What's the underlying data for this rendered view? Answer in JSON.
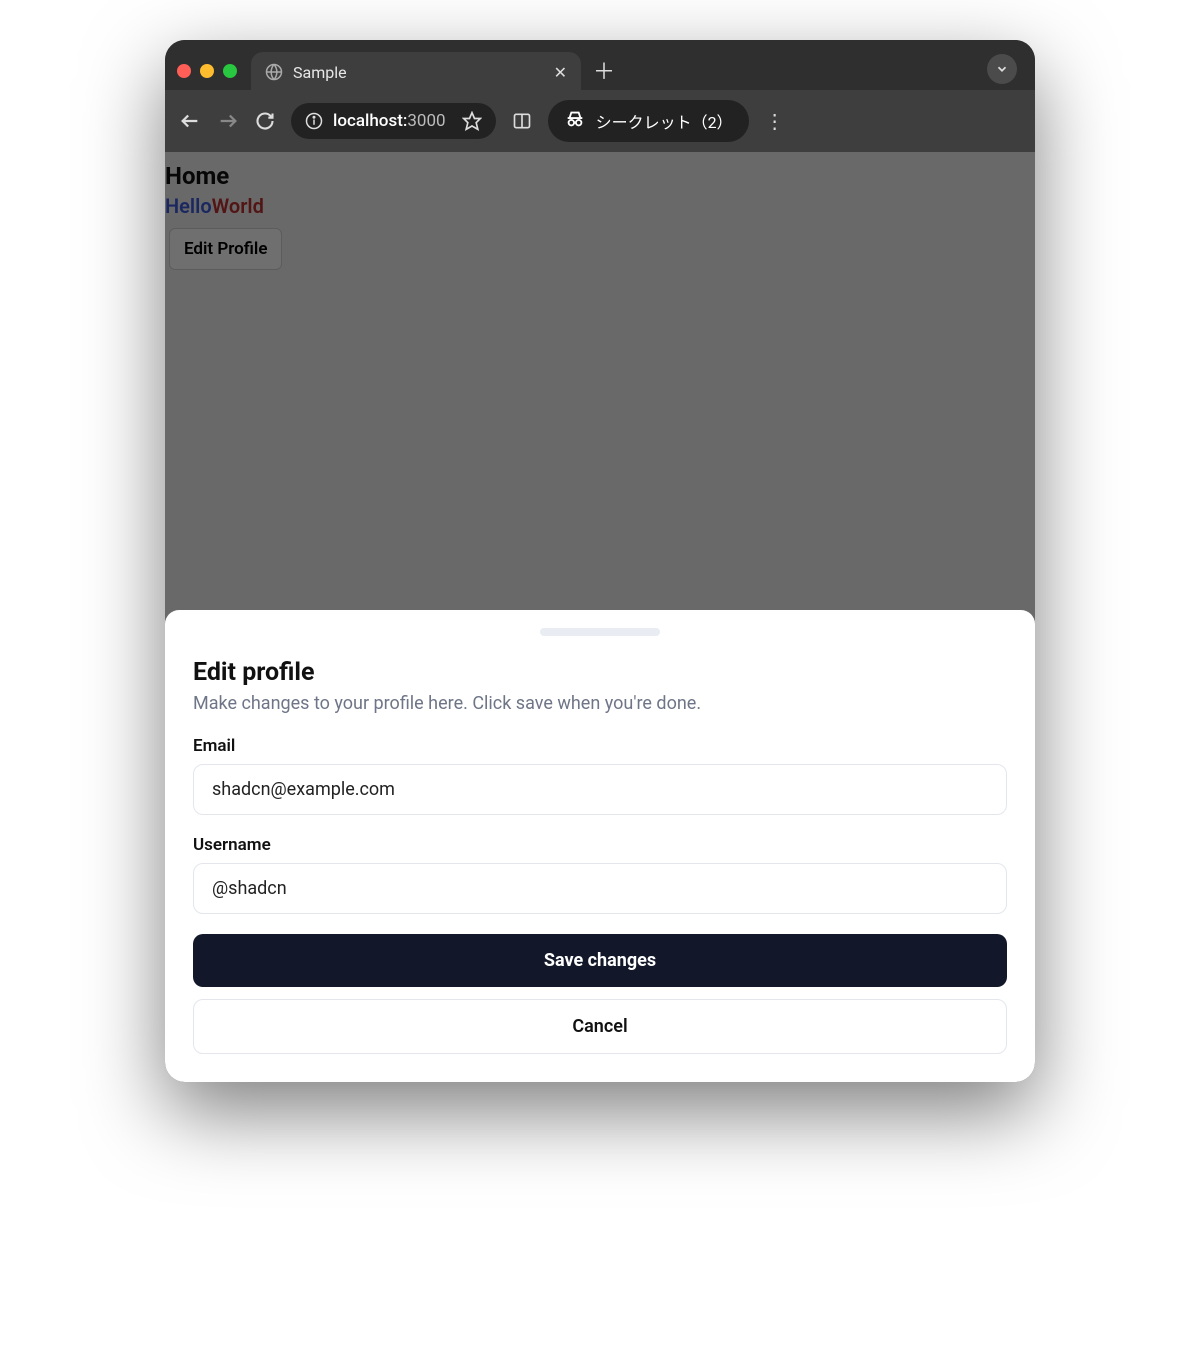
{
  "browser": {
    "tab_title": "Sample",
    "address_host": "localhost:",
    "address_port": "3000",
    "incognito_label": "シークレット（2）"
  },
  "page": {
    "title": "Home",
    "hello": "Hello",
    "world": "World",
    "edit_button": "Edit Profile"
  },
  "sheet": {
    "title": "Edit profile",
    "description": "Make changes to your profile here. Click save when you're done.",
    "email_label": "Email",
    "email_value": "shadcn@example.com",
    "username_label": "Username",
    "username_value": "@shadcn",
    "save_label": "Save changes",
    "cancel_label": "Cancel"
  }
}
